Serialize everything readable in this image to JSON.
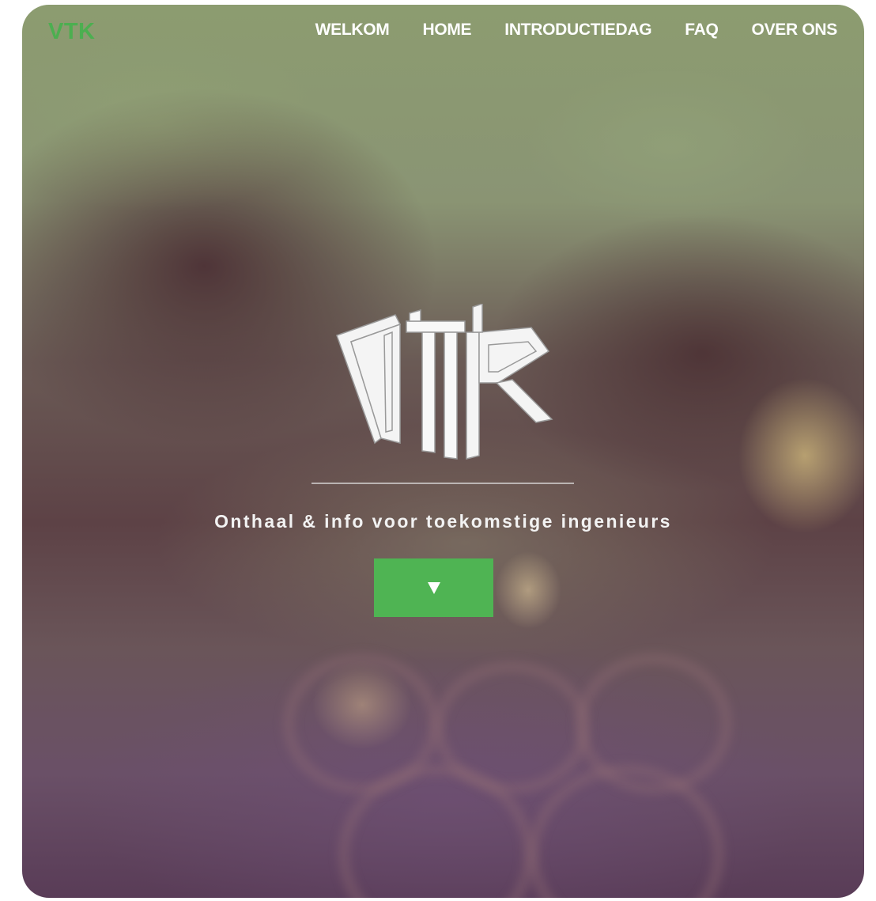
{
  "brand": {
    "label": "VTK",
    "color": "#4caf50"
  },
  "nav": {
    "items": [
      {
        "label": "WELKOM"
      },
      {
        "label": "HOME"
      },
      {
        "label": "INTRODUCTIEDAG"
      },
      {
        "label": "FAQ"
      },
      {
        "label": "OVER ONS"
      }
    ]
  },
  "hero": {
    "logo_text": "VTK",
    "tagline": "Onthaal & info voor toekomstige ingenieurs",
    "scroll_button_icon": "triangle-down-icon",
    "accent_color": "#4fb453"
  }
}
